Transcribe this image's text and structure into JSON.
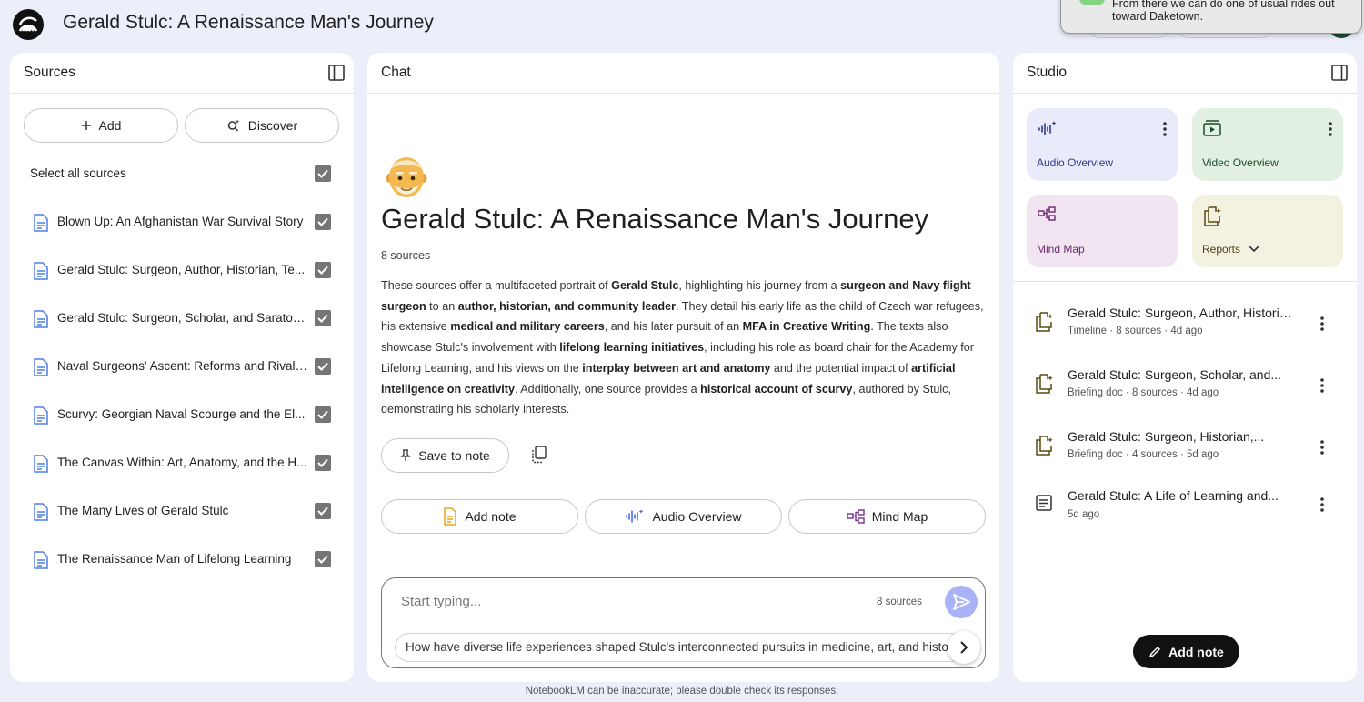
{
  "app": {
    "notebook_title": "Gerald Stulc: A Renaissance Man's Journey",
    "disclaimer": "NotebookLM can be inaccurate; please double check its responses."
  },
  "notification": {
    "text": "From there we can do one of usual rides out toward Daketown."
  },
  "sources_panel": {
    "title": "Sources",
    "add_label": "Add",
    "discover_label": "Discover",
    "select_all_label": "Select all sources",
    "items": [
      {
        "label": "Blown Up: An Afghanistan War Survival Story"
      },
      {
        "label": "Gerald Stulc: Surgeon, Author, Historian, Te..."
      },
      {
        "label": "Gerald Stulc: Surgeon, Scholar, and Saratog..."
      },
      {
        "label": "Naval Surgeons' Ascent: Reforms and Rivalri..."
      },
      {
        "label": "Scurvy: Georgian Naval Scourge and the El..."
      },
      {
        "label": "The Canvas Within: Art, Anatomy, and the H..."
      },
      {
        "label": "The Many Lives of Gerald Stulc"
      },
      {
        "label": "The Renaissance Man of Lifelong Learning"
      }
    ]
  },
  "chat_panel": {
    "title": "Chat",
    "emoji": "older-man-emoji",
    "heading": "Gerald Stulc: A Renaissance Man's Journey",
    "source_count": "8 sources",
    "summary": {
      "t1": "These sources offer a multifaceted portrait of ",
      "b1": "Gerald Stulc",
      "t2": ", highlighting his journey from a ",
      "b2": "surgeon and Navy flight surgeon",
      "t3": " to an ",
      "b3": "author, historian, and community leader",
      "t4": ". They detail his early life as the child of Czech war refugees, his extensive ",
      "b4": "medical and military careers",
      "t5": ", and his later pursuit of an ",
      "b5": "MFA in Creative Writing",
      "t6": ". The texts also showcase Stulc's involvement with ",
      "b6": "lifelong learning initiatives",
      "t7": ", including his role as board chair for the Academy for Lifelong Learning, and his views on the ",
      "b7": "interplay between art and anatomy",
      "t8": " and the potential impact of ",
      "b8": "artificial intelligence on creativity",
      "t9": ". Additionally, one source provides a ",
      "b9": "historical account of scurvy",
      "t10": ", authored by Stulc, demonstrating his scholarly interests."
    },
    "save_to_note_label": "Save to note",
    "actions": {
      "add_note": "Add note",
      "audio_overview": "Audio Overview",
      "mind_map": "Mind Map"
    },
    "input": {
      "placeholder": "Start typing...",
      "source_count": "8 sources",
      "suggestion": "How have diverse life experiences shaped Stulc's interconnected pursuits in medicine, art, and history?"
    }
  },
  "studio_panel": {
    "title": "Studio",
    "tiles": {
      "audio_overview": "Audio Overview",
      "video_overview": "Video Overview",
      "mind_map": "Mind Map",
      "reports": "Reports"
    },
    "notes": [
      {
        "title": "Gerald Stulc: Surgeon, Author, Historia...",
        "meta": "Timeline · 8 sources · 4d ago"
      },
      {
        "title": "Gerald Stulc: Surgeon, Scholar, and...",
        "meta": "Briefing doc · 8 sources · 4d ago"
      },
      {
        "title": "Gerald Stulc: Surgeon, Historian,...",
        "meta": "Briefing doc · 4 sources · 5d ago"
      },
      {
        "title": "Gerald Stulc: A Life of Learning and...",
        "meta": "5d ago"
      }
    ],
    "add_note_label": "Add note"
  },
  "colors": {
    "background": "#eceef9",
    "audio_tile": "#e9eafa",
    "video_tile": "#e1f0e1",
    "mindmap_tile": "#f1e5f1",
    "reports_tile": "#f3f2e1",
    "accent_blue": "#4a6cf7",
    "doc_icon": "#4f7fe8"
  }
}
